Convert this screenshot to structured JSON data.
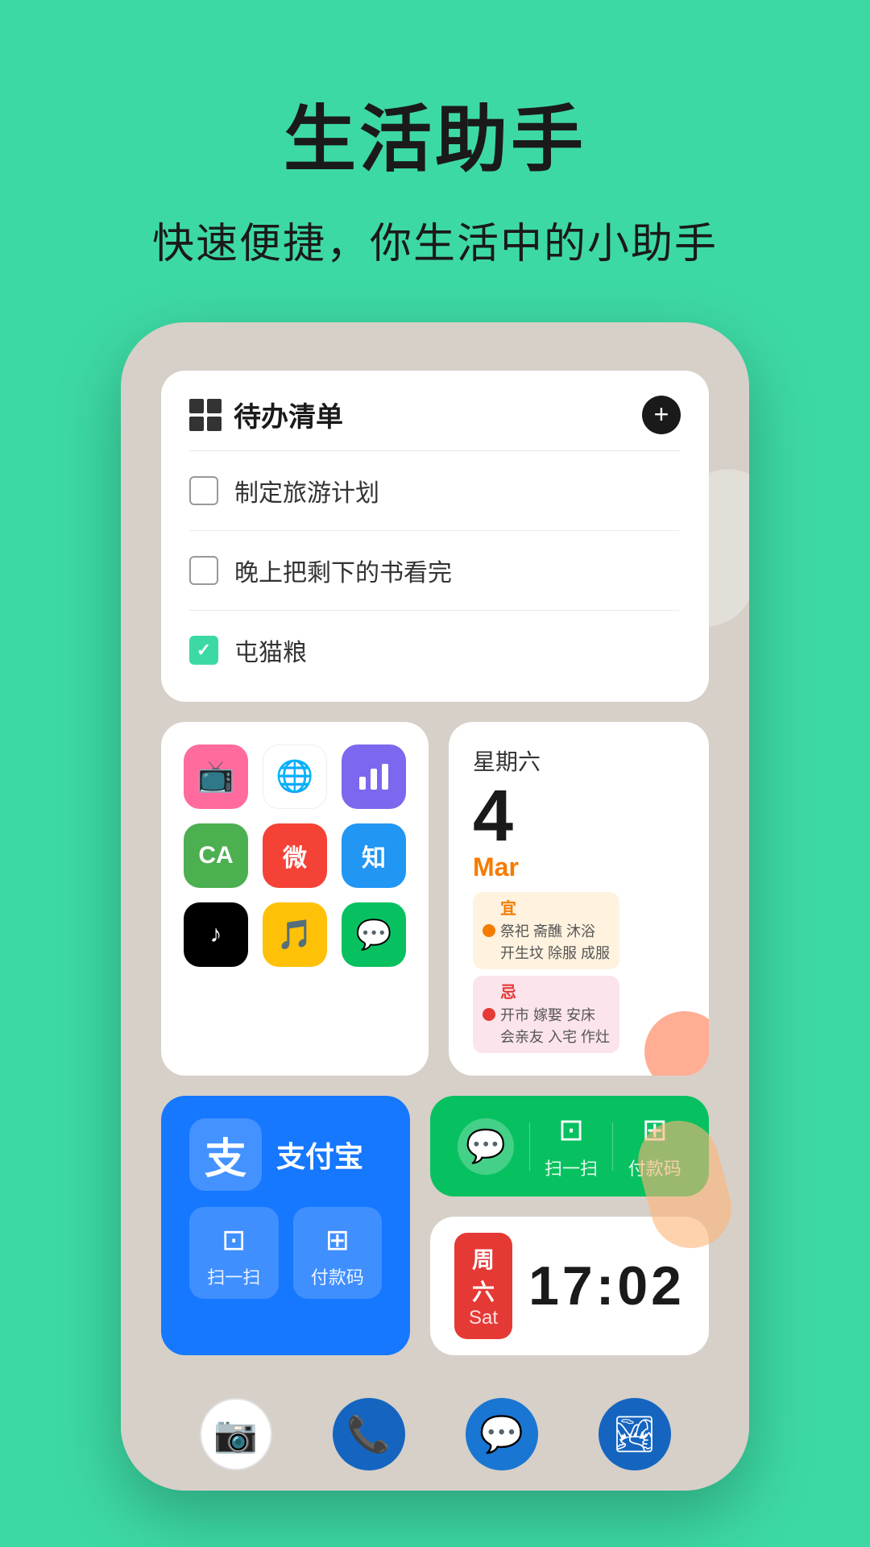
{
  "page": {
    "title": "生活助手",
    "subtitle": "快速便捷，你生活中的小助手",
    "background_color": "#3dd9a4"
  },
  "todo": {
    "title": "待办清单",
    "add_label": "+",
    "items": [
      {
        "text": "制定旅游计划",
        "checked": false
      },
      {
        "text": "晚上把剩下的书看完",
        "checked": false
      },
      {
        "text": "屯猫粮",
        "checked": true
      }
    ]
  },
  "apps": [
    {
      "name": "bilibili",
      "color": "pink",
      "icon": "📺"
    },
    {
      "name": "chrome",
      "color": "chrome",
      "icon": "🌐"
    },
    {
      "name": "app3",
      "color": "purple",
      "icon": "📊"
    },
    {
      "name": "app4",
      "color": "green",
      "icon": "🅰"
    },
    {
      "name": "weibo",
      "color": "red",
      "icon": "微"
    },
    {
      "name": "zhihu",
      "color": "blue",
      "icon": "知"
    },
    {
      "name": "tiktok",
      "color": "black",
      "icon": "♪"
    },
    {
      "name": "music",
      "color": "yellow",
      "icon": "🎵"
    },
    {
      "name": "wechat",
      "color": "wechat-green",
      "icon": "💬"
    }
  ],
  "calendar": {
    "date": "4",
    "weekday": "星期六",
    "month": "Mar",
    "auspicious_label": "宜",
    "auspicious_items": "祭祀 斋醮 沐浴\n开生坟 除服 成服",
    "inauspicious_label": "忌",
    "inauspicious_items": "开市 嫁娶 安床\n会亲友 入宅 作灶"
  },
  "alipay": {
    "name": "支付宝",
    "logo_char": "支",
    "scan_label": "扫一扫",
    "pay_label": "付款码",
    "scan_icon": "⊡",
    "pay_icon": "⊞"
  },
  "wechat_widget": {
    "scan_label": "扫一扫",
    "pay_label": "付款码"
  },
  "clock": {
    "weekday": "周六",
    "day_en": "Sat",
    "time": "17:02"
  },
  "dock": {
    "items": [
      {
        "name": "camera",
        "icon": "📷"
      },
      {
        "name": "phone",
        "icon": "📞"
      },
      {
        "name": "message",
        "icon": "💬"
      },
      {
        "name": "gallery",
        "icon": "🏞"
      }
    ]
  }
}
